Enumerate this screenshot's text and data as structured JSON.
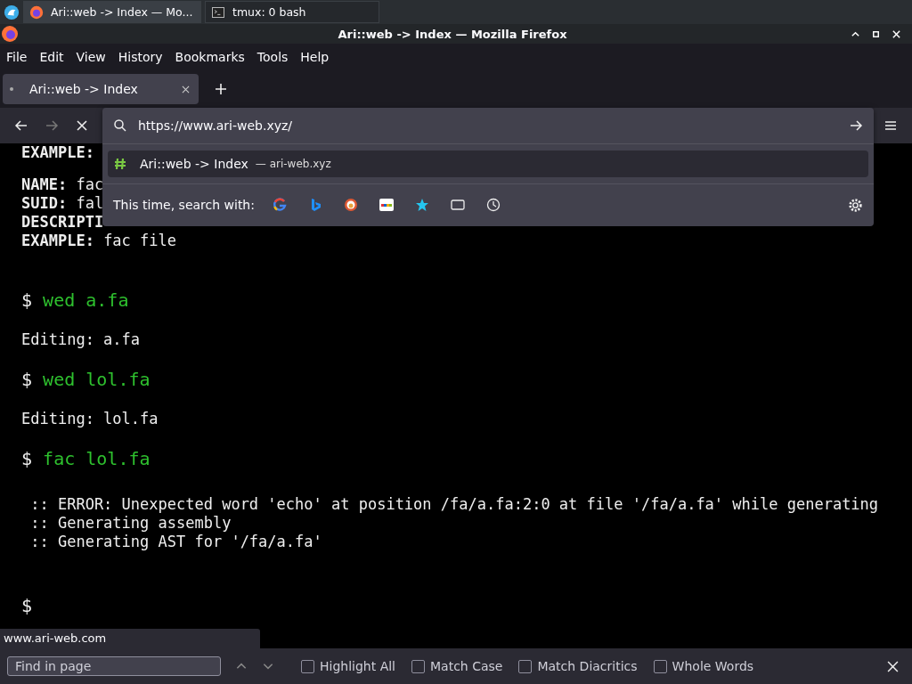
{
  "taskbar": {
    "tasks": [
      {
        "title": "Ari::web -> Index — Mo...",
        "kind": "browser",
        "selected": true
      },
      {
        "title": "tmux: 0 bash",
        "kind": "terminal",
        "selected": false
      }
    ]
  },
  "window": {
    "title": "Ari::web -> Index — Mozilla Firefox"
  },
  "menu": [
    "File",
    "Edit",
    "View",
    "History",
    "Bookmarks",
    "Tools",
    "Help"
  ],
  "tabs": [
    {
      "label": "Ari::web -> Index",
      "selected": true
    }
  ],
  "address_bar": {
    "value": "https://www.ari-web.xyz/"
  },
  "suggestions": [
    {
      "title": "Ari::web -> Index",
      "detail": "— ari-web.xyz",
      "selected": true
    }
  ],
  "search_with": {
    "label": "This time, search with:",
    "engines": [
      {
        "kind": "google"
      },
      {
        "kind": "bing"
      },
      {
        "kind": "duck"
      },
      {
        "kind": "ebay"
      },
      {
        "kind": "bookmarks"
      },
      {
        "kind": "tabs"
      },
      {
        "kind": "history"
      }
    ]
  },
  "terminal": {
    "prompt_symbol": "$",
    "blocks": [
      {
        "kind": "help",
        "lines": [
          {
            "key": "EXAMPLE:"
          }
        ]
      },
      {
        "kind": "help",
        "lines": [
          {
            "key": "NAME:",
            "value": "fac"
          },
          {
            "key": "SUID:",
            "value": "fal"
          },
          {
            "key": "DESCRIPTI"
          },
          {
            "key": "EXAMPLE:",
            "value": "fac file"
          }
        ]
      },
      {
        "kind": "prompt",
        "command": "wed a.fa"
      },
      {
        "kind": "output",
        "lines": [
          "Editing: a.fa"
        ]
      },
      {
        "kind": "prompt",
        "command": "wed lol.fa"
      },
      {
        "kind": "output",
        "lines": [
          "Editing: lol.fa"
        ]
      },
      {
        "kind": "prompt",
        "command": "fac lol.fa"
      },
      {
        "kind": "log",
        "lines": [
          " :: ERROR: Unexpected word 'echo' at position /fa/a.fa:2:0 at file '/fa/a.fa' while generating",
          " :: Generating assembly",
          " :: Generating AST for '/fa/a.fa'"
        ]
      },
      {
        "kind": "prompt"
      }
    ]
  },
  "status_link": "www.ari-web.com",
  "find_bar": {
    "placeholder": "Find in page",
    "options": [
      {
        "label": "Highlight All",
        "checked": false
      },
      {
        "label": "Match Case",
        "checked": false
      },
      {
        "label": "Match Diacritics",
        "checked": false
      },
      {
        "label": "Whole Words",
        "checked": false
      }
    ]
  }
}
